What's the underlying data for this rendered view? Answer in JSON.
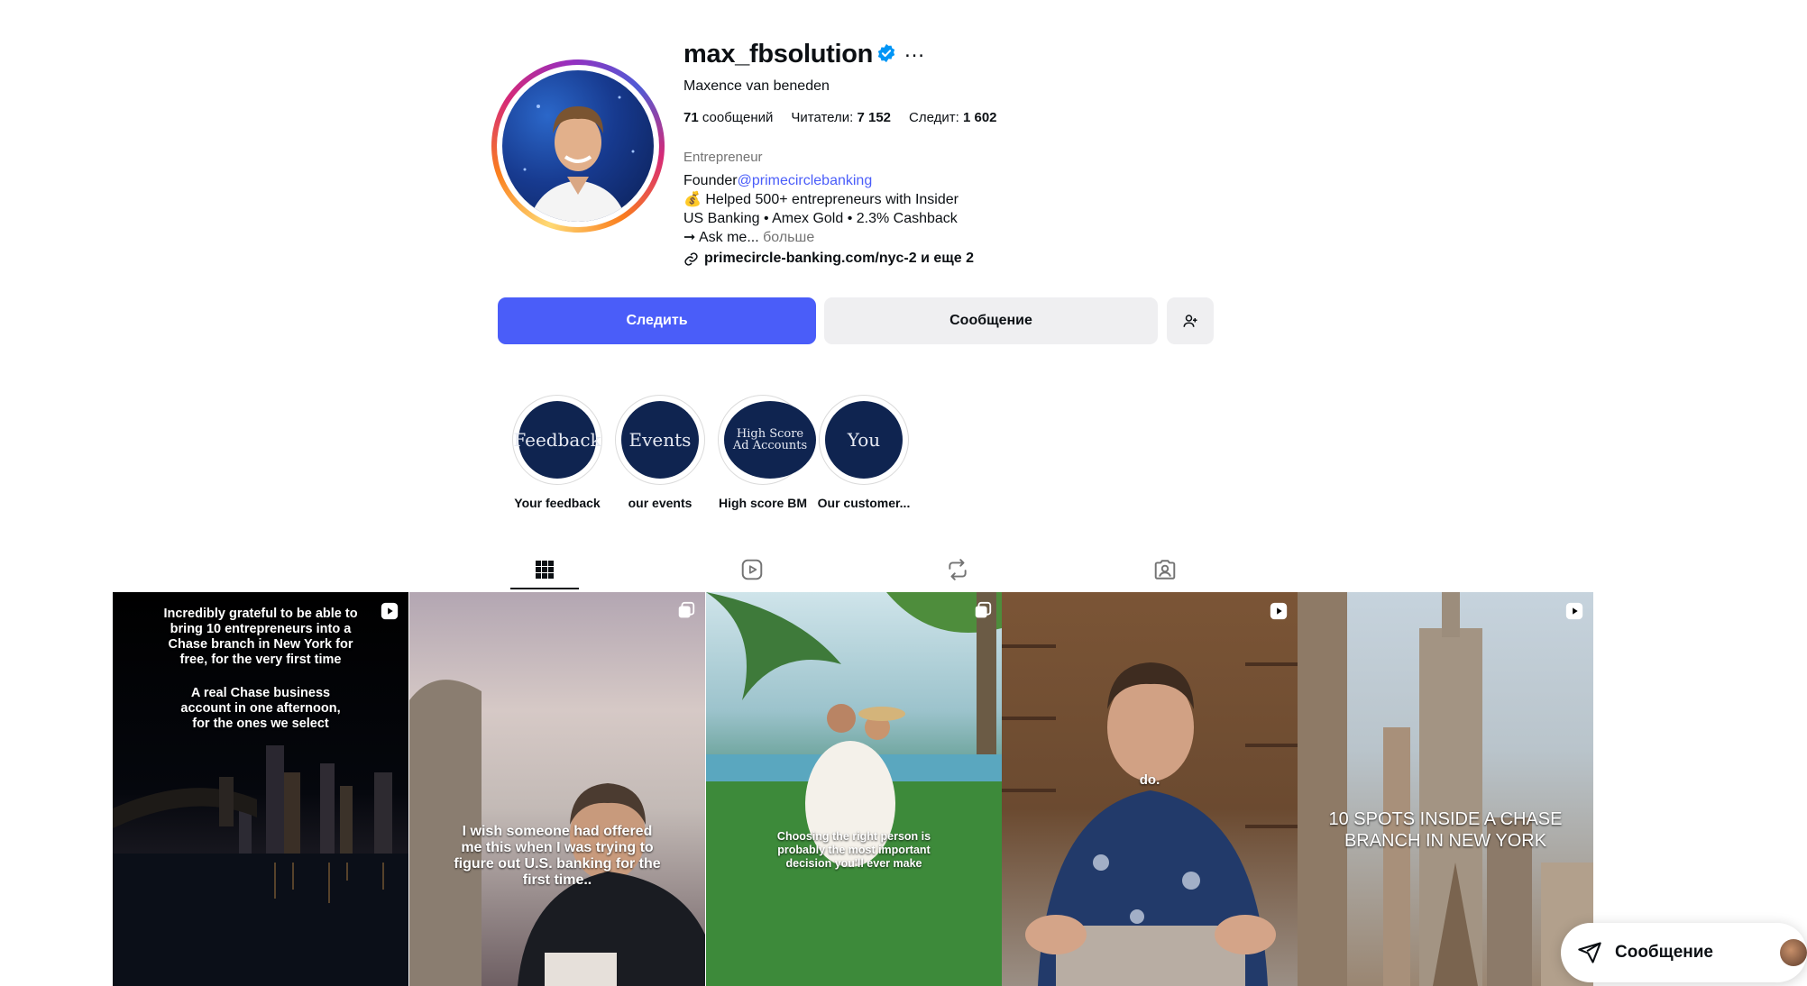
{
  "profile": {
    "username": "max_fbsolution",
    "more_icon": "…",
    "full_name": "Maxence van beneden",
    "stats": [
      {
        "num": "71",
        "label": "сообщений",
        "num_first": true
      },
      {
        "num": "7 152",
        "label": "Читатели:",
        "num_first": false
      },
      {
        "num": "1 602",
        "label": "Следит:",
        "num_first": false
      }
    ],
    "category": "Entrepreneur",
    "bio": {
      "line1_prefix": "Founder",
      "mention": "@primecirclebanking",
      "line2": "💰 Helped 500+ entrepreneurs with Insider",
      "line3": "US Banking • Amex Gold • 2.3% Cashback",
      "line4": "➞ Ask me...",
      "more": "больше"
    },
    "link": "primecircle-banking.com/nyc-2 и еще 2"
  },
  "actions": {
    "follow_label": "Следить",
    "message_label": "Сообщение"
  },
  "highlights": [
    {
      "label": "Your feedback",
      "cover_text": "Feedback"
    },
    {
      "label": "our events",
      "cover_text": "Events"
    },
    {
      "label": "High score BM",
      "cover_text": "High Score Ad Accounts"
    },
    {
      "label": "Our customer...",
      "cover_text": "You"
    }
  ],
  "tabs": [
    "posts-grid-icon",
    "reels-icon",
    "reposts-icon",
    "tagged-icon"
  ],
  "posts": [
    {
      "caption_top": "Incredibly grateful to be able to bring 10 entrepreneurs into a Chase branch in New York for free, for the very first time",
      "caption_top2": "A real Chase business account in one afternoon, for the ones we select"
    },
    {
      "caption_mid": "I wish someone had offered me this when I was trying to figure out U.S. banking for the first time.."
    },
    {
      "caption_mid": "Choosing the right person is probably the most important decision you'll ever make"
    },
    {
      "caption_mid": "do."
    },
    {
      "caption_mid": "10 SPOTS INSIDE A CHASE BRANCH IN NEW YORK"
    }
  ],
  "floating": {
    "label": "Сообщение"
  },
  "colors": {
    "accent": "#4a5df9",
    "verified": "#0095f6"
  }
}
